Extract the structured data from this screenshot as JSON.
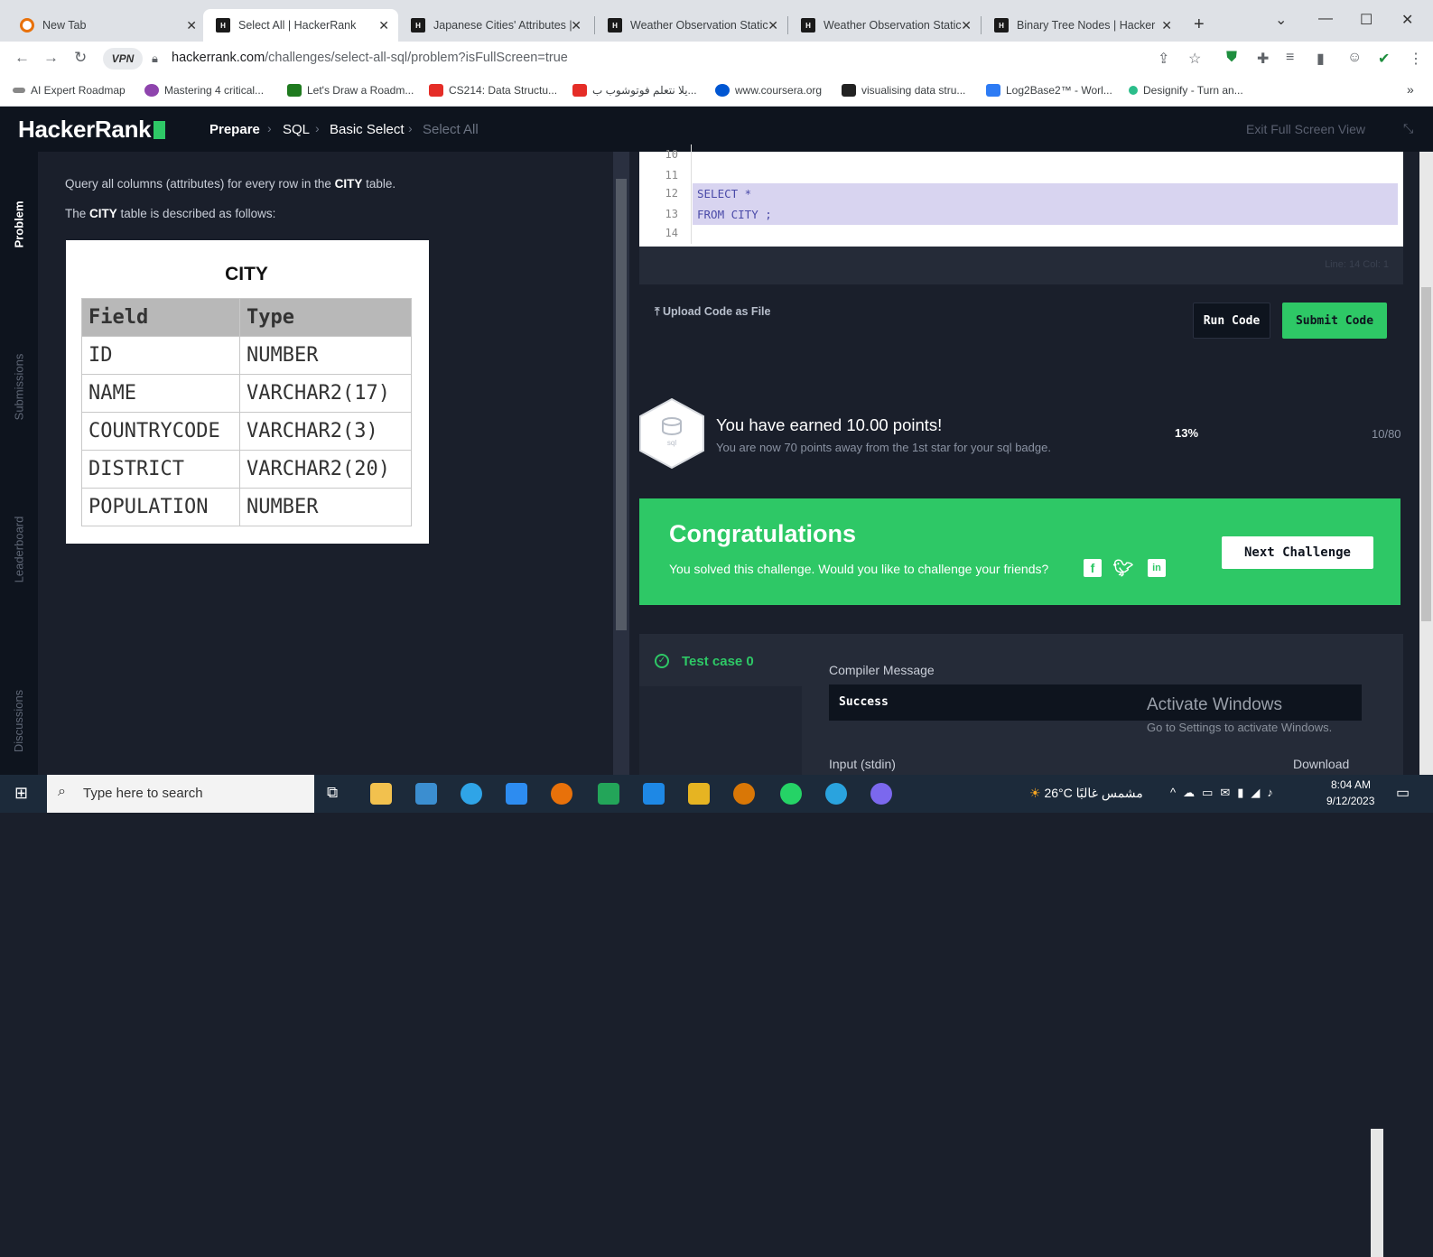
{
  "browser": {
    "tabs": [
      {
        "title": "New Tab"
      },
      {
        "title": "Select All | HackerRank"
      },
      {
        "title": "Japanese Cities' Attributes |"
      },
      {
        "title": "Weather Observation Static"
      },
      {
        "title": "Weather Observation Static"
      },
      {
        "title": "Binary Tree Nodes | Hacker"
      }
    ],
    "url_host": "hackerrank.com",
    "url_path": "/challenges/select-all-sql/problem?isFullScreen=true",
    "vpn_label": "VPN",
    "bookmarks": [
      {
        "label": "AI Expert Roadmap",
        "color": "#555555"
      },
      {
        "label": "Mastering 4 critical...",
        "color": "#8e44ad"
      },
      {
        "label": "Let's Draw a Roadm...",
        "color": "#1f7a1f"
      },
      {
        "label": "CS214: Data Structu...",
        "color": "#e52d27"
      },
      {
        "label": "يلا نتعلم فوتوشوب ب...",
        "color": "#e52d27"
      },
      {
        "label": "www.coursera.org",
        "color": "#0056d2"
      },
      {
        "label": "visualising data stru...",
        "color": "#222222"
      },
      {
        "label": "Log2Base2™ - Worl...",
        "color": "#2d7bf4"
      },
      {
        "label": "Designify - Turn an...",
        "color": "#2bbd8a"
      }
    ]
  },
  "header": {
    "logo": "HackerRank",
    "breadcrumbs": [
      "Prepare",
      "SQL",
      "Basic Select",
      "Select All"
    ],
    "exit_label": "Exit Full Screen View",
    "accent": "#2ec866"
  },
  "sidenav": [
    "Problem",
    "Submissions",
    "Leaderboard",
    "Discussions"
  ],
  "problem": {
    "line1_pre": "Query all columns (attributes) for every row in the ",
    "line1_bold": "CITY",
    "line1_post": " table.",
    "line2_pre": "The ",
    "line2_bold": "CITY",
    "line2_post": " table is described as follows:",
    "table_title": "CITY",
    "columns": [
      "Field",
      "Type"
    ],
    "rows": [
      [
        "ID",
        "NUMBER"
      ],
      [
        "NAME",
        "VARCHAR2(17)"
      ],
      [
        "COUNTRYCODE",
        "VARCHAR2(3)"
      ],
      [
        "DISTRICT",
        "VARCHAR2(20)"
      ],
      [
        "POPULATION",
        "NUMBER"
      ]
    ]
  },
  "editor": {
    "lines": [
      {
        "n": "10",
        "code": ""
      },
      {
        "n": "11",
        "code": ""
      },
      {
        "n": "12",
        "code": "SELECT *"
      },
      {
        "n": "13",
        "code": "FROM CITY ;"
      },
      {
        "n": "14",
        "code": ""
      }
    ],
    "status": "Line: 14 Col: 1"
  },
  "actions": {
    "upload": "Upload Code as File",
    "run": "Run Code",
    "submit": "Submit Code"
  },
  "points": {
    "badge_label": "sql",
    "title": "You have earned 10.00 points!",
    "subtitle": "You are now 70 points away from the 1st star for your sql badge.",
    "percent": "13%",
    "progress": "10/80"
  },
  "congrats": {
    "heading": "Congratulations",
    "message": "You solved this challenge. Would you like to challenge your friends?",
    "next": "Next Challenge"
  },
  "results": {
    "testcase": "Test case 0",
    "compiler_label": "Compiler Message",
    "compiler_value": "Success",
    "stdin_label": "Input (stdin)",
    "download": "Download"
  },
  "watermark": {
    "line1": "Activate Windows",
    "line2": "Go to Settings to activate Windows."
  },
  "taskbar": {
    "search_placeholder": "Type here to search",
    "weather": "26°C مشمس غالبًا",
    "time": "8:04 AM",
    "date": "9/12/2023"
  }
}
